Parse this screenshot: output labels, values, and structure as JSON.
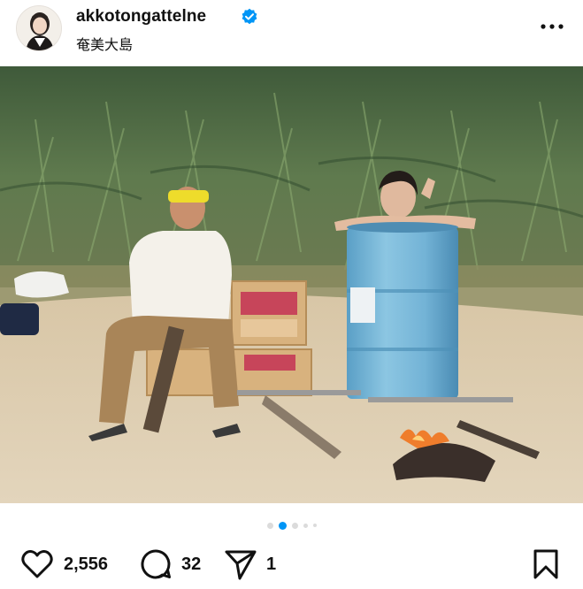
{
  "post": {
    "username": "akkotongattelne",
    "verified": true,
    "location": "奄美大島",
    "photo_description_icon": "photo",
    "carousel": {
      "total": 5,
      "active_index": 1
    },
    "likes": "2,556",
    "comments": "32",
    "shares": "1"
  },
  "colors": {
    "accent": "#0095f6",
    "verified": "#0095f6",
    "text": "#111111",
    "dot_inactive": "#dbdbdb"
  },
  "icons": {
    "like": "heart-icon",
    "comment": "comment-icon",
    "share": "send-icon",
    "save": "bookmark-icon",
    "more": "more-horizontal-icon",
    "verified": "verified-badge-icon"
  }
}
